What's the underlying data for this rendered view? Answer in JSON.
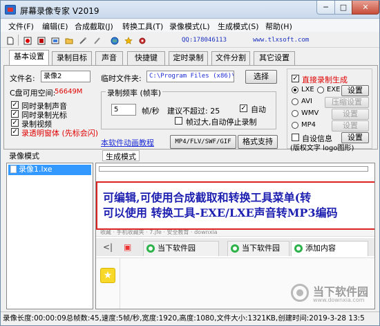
{
  "window": {
    "title": "屏幕录像专家 V2019",
    "min_glyph": "─",
    "max_glyph": "□",
    "close_glyph": "✕"
  },
  "menu": [
    "文件(F)",
    "编辑(E)",
    "合成截取(J)",
    "转换工具(T)",
    "录像模式(L)",
    "生成模式(S)",
    "帮助(H)"
  ],
  "toolbar": {
    "icons": [
      "new-file-icon",
      "record-icon",
      "stop-icon",
      "screenshot-icon",
      "folder-icon",
      "wand-icon",
      "globe-icon",
      "star-icon",
      "gear-icon"
    ],
    "qq": "QQ:178046113",
    "site": "www.tlxsoft.com"
  },
  "tabs": [
    "基本设置",
    "录制目标",
    "声音",
    "快捷键",
    "定时录制",
    "文件分割",
    "其它设置"
  ],
  "basic": {
    "filename_label": "文件名:",
    "filename_value": "录像2",
    "tempfolder_label": "临时文件夹:",
    "tempfolder_value": "C:\\Program Files (x86)\\",
    "choose_button": "选择",
    "disk_label": "C盘可用空间:",
    "disk_value": "56649M",
    "options": [
      {
        "label": "同时录制声音",
        "checked": true
      },
      {
        "label": "同时录制光标",
        "checked": true
      },
      {
        "label": "录制视频",
        "checked": true
      },
      {
        "label": "录透明窗体 (先标会闪)",
        "checked": true
      }
    ],
    "frame_group_title": "录制频率 (帧率)",
    "fps_value": "5",
    "fps_unit": "帧/秒",
    "fps_advice": "建议不超过: 25",
    "auto_label": "自动",
    "auto_checked": true,
    "stop_label": "帧过大,自动停止录制",
    "stop_checked": false,
    "tutorial_link": "本软件动画教程",
    "format_button": "MP4/FLV/SWF/GIF",
    "format_support_button": "格式支持",
    "direct_label": "直接录制生成",
    "direct_checked": true,
    "formats": [
      {
        "label": "LXE",
        "selected": true
      },
      {
        "label": "EXE",
        "selected": false
      },
      {
        "label": "AVI",
        "selected": false
      },
      {
        "label": "WMV",
        "selected": false
      },
      {
        "label": "MP4",
        "selected": false
      }
    ],
    "settings_button": "设置",
    "compress_button": "压缩设置",
    "custom_info_label": "自设信息",
    "custom_info_checked": false,
    "copyright_label": "(版权文字 logo图形)"
  },
  "bottom": {
    "recording_mode_label": "录像模式",
    "generate_mode_label": "生成模式",
    "list": [
      "录像1.lxe"
    ],
    "notice_line1": "可编辑,可使用合成截取和转换工具菜单(转",
    "notice_line2": "可以使用 转换工具-EXE/LXE声音转MP3编码",
    "browser_bookmarks": "收藏 · 手机收藏夹 · 7.jfe · 安全教育 · downxia",
    "browser_tabs": [
      "当下软件园",
      "当下软件园",
      "添加内容"
    ],
    "watermark_text": "当下软件园",
    "watermark_url": "www.downxia.com"
  },
  "status": "录像长度:00:00:09总帧数:45,速度:5帧/秒,宽度:1920,高度:1080,文件大小:1321KB,创建时间:2019-3-28 13:5"
}
